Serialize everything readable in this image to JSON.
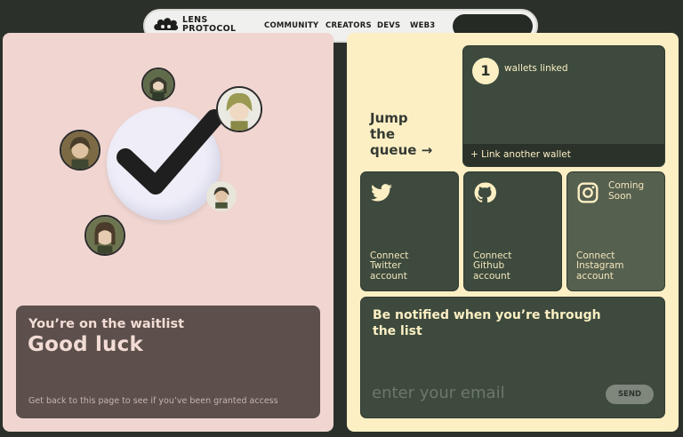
{
  "nav": {
    "brand_line1": "LENS",
    "brand_line2": "PROTOCOL",
    "links": [
      "COMMUNITY",
      "CREATORS",
      "DEVS",
      "WEB3"
    ]
  },
  "waitlist": {
    "line1": "You’re on the waitlist",
    "line2": "Good luck",
    "hint": "Get back to this page to see if you’ve been granted access"
  },
  "queue": {
    "jump_l1": "Jump",
    "jump_l2": "the",
    "jump_l3": "queue →"
  },
  "wallet": {
    "count": "1",
    "label": "wallets linked",
    "link": "+ Link another wallet"
  },
  "socials": {
    "twitter": [
      "Connect",
      "Twitter",
      "account"
    ],
    "github": [
      "Connect",
      "Github",
      "account"
    ],
    "instagram": [
      "Connect",
      "Instagram",
      "account"
    ],
    "instagram_badge": [
      "Coming",
      "Soon"
    ]
  },
  "notify": {
    "title": "Be notified when you’re through the list",
    "placeholder": "enter your email",
    "send": "SEND"
  },
  "colors": {
    "background": "#2c302b",
    "left_panel": "#f0d5d1",
    "right_panel": "#fcefc4",
    "card": "#3d4a3d"
  }
}
